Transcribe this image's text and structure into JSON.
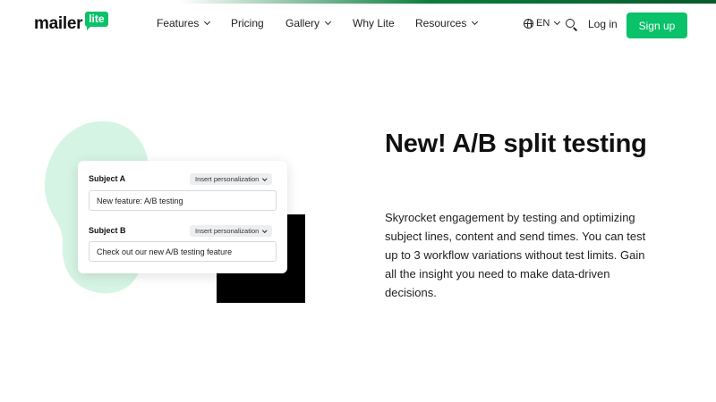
{
  "header": {
    "logo": {
      "word": "mailer",
      "badge": "lite"
    },
    "nav": [
      {
        "label": "Features",
        "dropdown": true
      },
      {
        "label": "Pricing",
        "dropdown": false
      },
      {
        "label": "Gallery",
        "dropdown": true
      },
      {
        "label": "Why Lite",
        "dropdown": false
      },
      {
        "label": "Resources",
        "dropdown": true
      }
    ],
    "language": "EN",
    "login_label": "Log in",
    "signup_label": "Sign up"
  },
  "illustration": {
    "subject_a": {
      "label": "Subject A",
      "button": "Insert personalization",
      "value": "New feature: A/B testing"
    },
    "subject_b": {
      "label": "Subject B",
      "button": "Insert personalization",
      "value": "Check out our new A/B testing feature"
    }
  },
  "hero": {
    "title": "New! A/B split testing",
    "description": "Skyrocket engagement by testing and optimizing subject lines, content and send times. You can test up to 3 workflow variations without test limits. Gain all the insight you need to make data-driven decisions."
  },
  "colors": {
    "brand_green": "#09c269",
    "blob_mint": "#d6f4e3",
    "text": "#111111"
  },
  "icons": [
    "globe-icon",
    "search-icon",
    "chevron-down-icon"
  ]
}
